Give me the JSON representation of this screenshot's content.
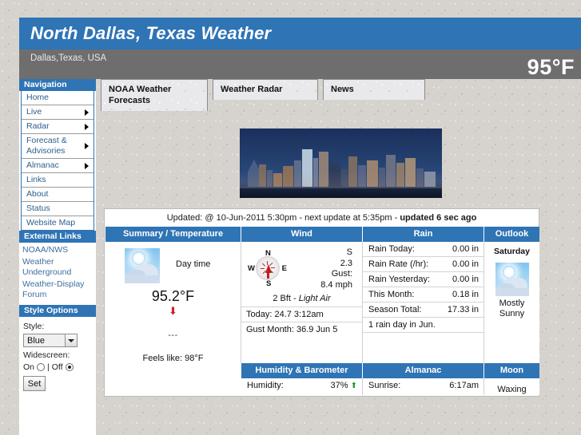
{
  "header": {
    "site_title": "North Dallas, Texas Weather",
    "location": "Dallas,Texas, USA",
    "current_temp": "95°F"
  },
  "sidebar": {
    "nav_heading": "Navigation",
    "nav_items": [
      {
        "label": "Home",
        "has_submenu": false
      },
      {
        "label": "Live",
        "has_submenu": true
      },
      {
        "label": "Radar",
        "has_submenu": true
      },
      {
        "label": "Forecast & Advisories",
        "has_submenu": true
      },
      {
        "label": "Almanac",
        "has_submenu": true
      },
      {
        "label": "Links",
        "has_submenu": false
      },
      {
        "label": "About",
        "has_submenu": false
      },
      {
        "label": "Status",
        "has_submenu": false
      },
      {
        "label": "Website Map",
        "has_submenu": false
      }
    ],
    "external_heading": "External Links",
    "external_links": [
      "NOAA/NWS",
      "Weather Underground",
      "Weather-Display Forum"
    ],
    "style_heading": "Style Options",
    "style_label": "Style:",
    "style_value": "Blue",
    "style_options": [
      "Blue"
    ],
    "widescreen_label": "Widescreen:",
    "widescreen_on_label": "On",
    "widescreen_separator": "|",
    "widescreen_off_label": "Off",
    "widescreen_selected": "Off",
    "set_button": "Set"
  },
  "tabs": [
    {
      "label": "NOAA Weather Forecasts",
      "active": true
    },
    {
      "label": "Weather Radar",
      "active": false
    },
    {
      "label": "News",
      "active": false
    }
  ],
  "weather_panel": {
    "updated_prefix": "Updated: @ 10-Jun-2011 5:30pm - next update at 5:35pm  - ",
    "updated_bold": "updated 6 sec ago",
    "columns": [
      "Summary / Temperature",
      "Wind",
      "Rain",
      "Outlook"
    ],
    "summary": {
      "icon": "mostly-sunny-icon",
      "daytime_label": "Day time",
      "temperature": "95.2°F",
      "trend_arrow": "down",
      "dashes": "---",
      "feels_like": "Feels like: 98°F"
    },
    "wind": {
      "compass_labels": {
        "n": "N",
        "s": "S",
        "e": "E",
        "w": "W"
      },
      "direction": "S",
      "speed": "2.3",
      "gust_label": "Gust:",
      "gust_value": "8.4 mph",
      "beaufort_num": "2 Bft - ",
      "beaufort_desc": "Light Air",
      "today_row": "Today: 24.7 3:12am",
      "gust_month_row": "Gust Month: 36.9 Jun 5"
    },
    "rain": {
      "rows": [
        {
          "label": "Rain Today:",
          "value": "0.00 in"
        },
        {
          "label": "Rain Rate (/hr):",
          "value": "0.00 in"
        },
        {
          "label": "Rain Yesterday:",
          "value": "0.00 in"
        },
        {
          "label": "This Month:",
          "value": "0.18 in"
        },
        {
          "label": "Season Total:",
          "value": "17.33 in"
        }
      ],
      "note": "1 rain day in Jun."
    },
    "outlook": {
      "day": "Saturday",
      "icon": "mostly-sunny-icon",
      "condition_line1": "Mostly",
      "condition_line2": "Sunny"
    },
    "band2_headers": {
      "humidity": "Humidity & Barometer",
      "almanac": "Almanac",
      "moon": "Moon"
    },
    "humidity": {
      "label": "Humidity:",
      "value": "37%",
      "trend": "up"
    },
    "almanac": {
      "label": "Sunrise:",
      "value": "6:17am"
    },
    "moon": {
      "phase_partial": "Waxing"
    }
  }
}
